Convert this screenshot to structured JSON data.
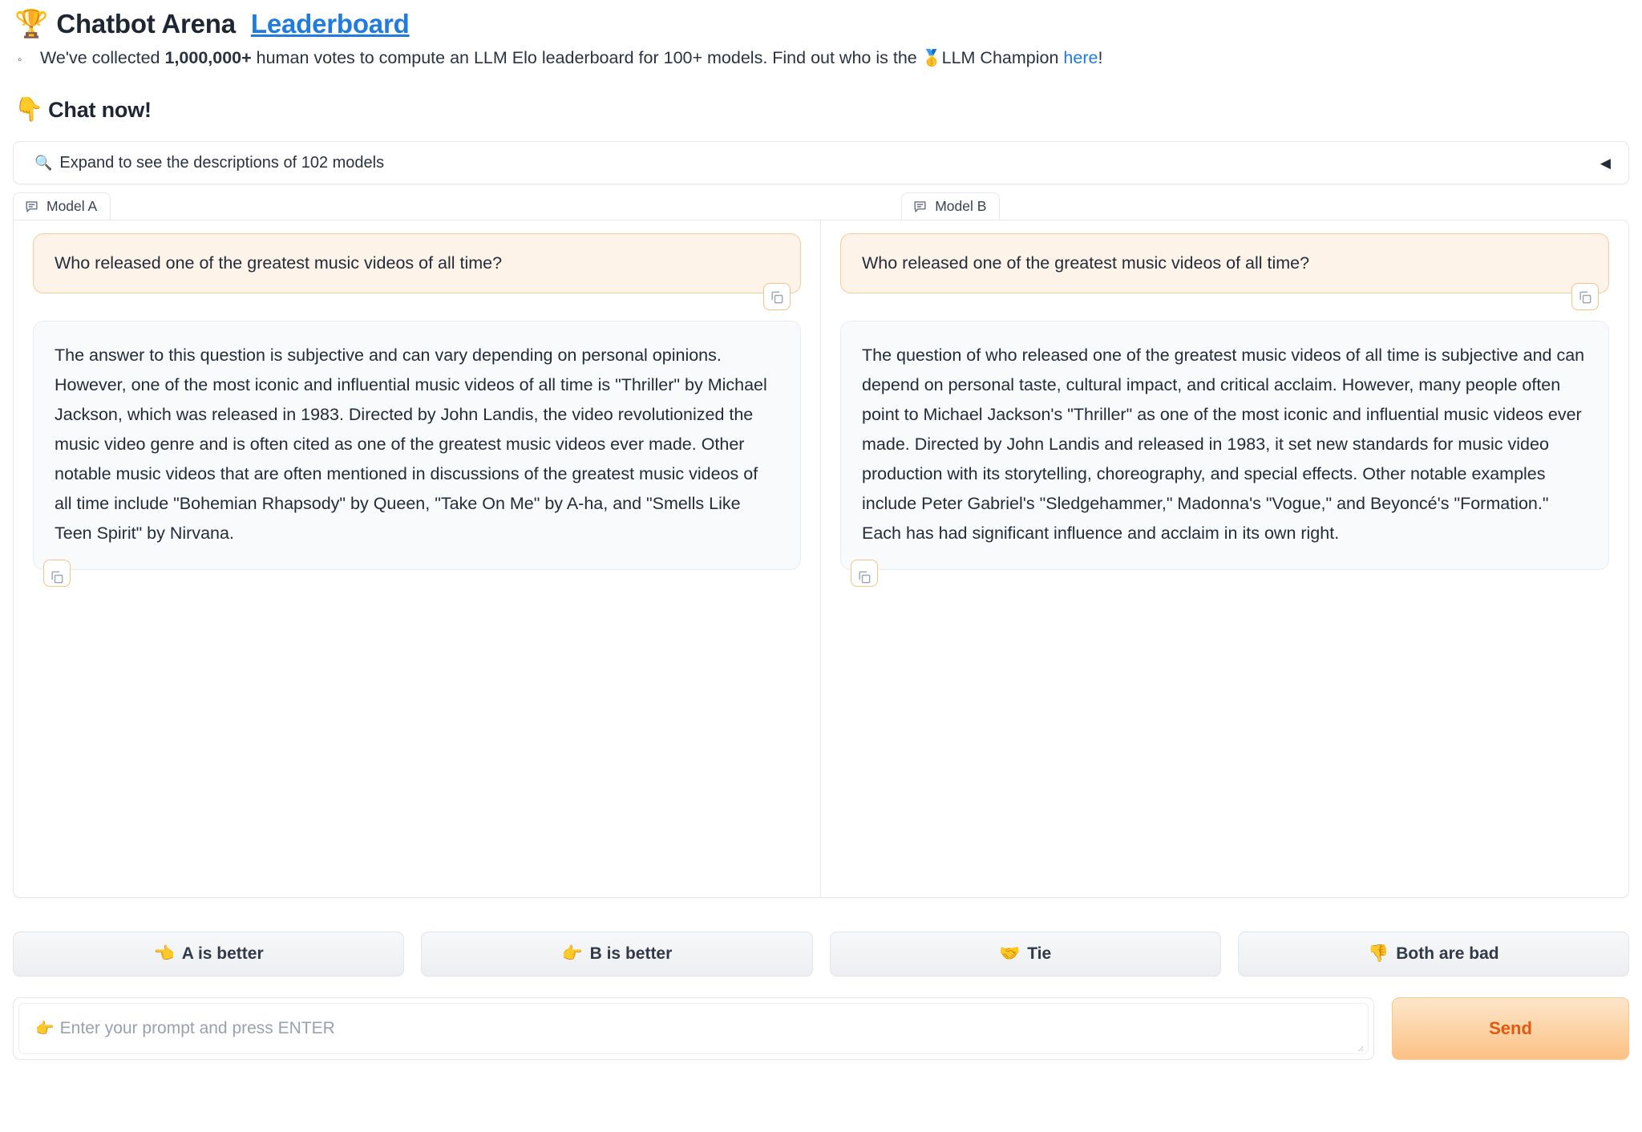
{
  "header": {
    "trophy_emoji": "🏆",
    "title": "Chatbot Arena",
    "title_link": "Leaderboard",
    "bullet_marker": "◦",
    "bullet_prefix": "We've collected ",
    "bullet_bold": "1,000,000+",
    "bullet_middle": " human votes to compute an LLM Elo leaderboard for 100+ models. Find out who is the ",
    "medal_emoji": "🥇",
    "bullet_champion": "LLM Champion ",
    "bullet_link": "here",
    "bullet_suffix": "!",
    "chat_now_emoji": "👇",
    "chat_now": "Chat now!"
  },
  "accordion": {
    "search_icon": "🔍",
    "label": "Expand to see the descriptions of 102 models",
    "arrow": "◀"
  },
  "battle": {
    "model_a": {
      "tab_label": "Model A",
      "user_message": "Who released one of the greatest music videos of all time?",
      "bot_message": "The answer to this question is subjective and can vary depending on personal opinions. However, one of the most iconic and influential music videos of all time is \"Thriller\" by Michael Jackson, which was released in 1983. Directed by John Landis, the video revolutionized the music video genre and is often cited as one of the greatest music videos ever made. Other notable music videos that are often mentioned in discussions of the greatest music videos of all time include \"Bohemian Rhapsody\" by Queen, \"Take On Me\" by A-ha, and \"Smells Like Teen Spirit\" by Nirvana."
    },
    "model_b": {
      "tab_label": "Model B",
      "user_message": "Who released one of the greatest music videos of all time?",
      "bot_message": "The question of who released one of the greatest music videos of all time is subjective and can depend on personal taste, cultural impact, and critical acclaim. However, many people often point to Michael Jackson's \"Thriller\" as one of the most iconic and influential music videos ever made. Directed by John Landis and released in 1983, it set new standards for music video production with its storytelling, choreography, and special effects. Other notable examples include Peter Gabriel's \"Sledgehammer,\" Madonna's \"Vogue,\" and Beyoncé's \"Formation.\" Each has had significant influence and acclaim in its own right."
    }
  },
  "votes": [
    {
      "emoji": "👈",
      "label": "A is better"
    },
    {
      "emoji": "👉",
      "label": "B is better"
    },
    {
      "emoji": "🤝",
      "label": "Tie"
    },
    {
      "emoji": "👎",
      "label": "Both are bad"
    }
  ],
  "input": {
    "placeholder_emoji": "👉",
    "placeholder": "Enter your prompt and press ENTER",
    "value": "",
    "send_label": "Send"
  },
  "colors": {
    "link": "#1f7be0",
    "user_bubble_bg": "#fdf3e9",
    "user_bubble_border": "#f8cb9b",
    "bot_bubble_bg": "#f8fafc",
    "send_text": "#e2590f",
    "text": "#242c3a"
  }
}
